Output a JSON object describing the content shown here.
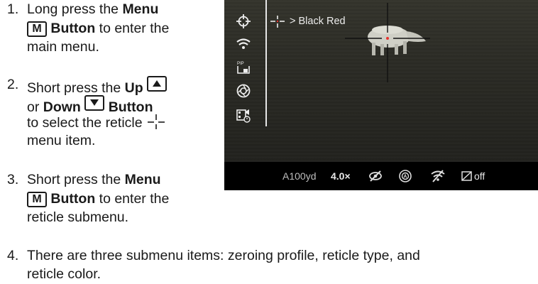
{
  "steps": [
    {
      "num": "1.",
      "lines": {
        "a_pre": "Long press the ",
        "a_bold": "Menu",
        "b_key": "M",
        "b_bold": "Button",
        "b_post": " to enter the",
        "c": "main menu."
      }
    },
    {
      "num": "2.",
      "lines": {
        "a_pre": "Short press the ",
        "a_bold": "Up",
        "b_pre": "or ",
        "b_bold1": "Down",
        "b_bold2": "Button",
        "c": "to select the reticle",
        "d": "menu item."
      }
    },
    {
      "num": "3.",
      "lines": {
        "a_pre": "Short press the ",
        "a_bold": "Menu",
        "b_key": "M",
        "b_bold": "Button",
        "b_post": " to enter the",
        "c": "reticle submenu."
      }
    },
    {
      "num": "4.",
      "lines": {
        "a": "There are three submenu items: zeroing profile, reticle type, and",
        "b": "reticle color."
      }
    }
  ],
  "device": {
    "submenu_label": "> Black Red",
    "menu_icons": [
      "reticle-icon",
      "wifi-icon",
      "pip-icon",
      "aperture-icon",
      "video-settings-icon"
    ],
    "status_bar": {
      "distance": "A100yd",
      "zoom": "4.0×",
      "visibility_off_icon": "eye-off-icon",
      "status_icon": "circle-a-icon",
      "wifi_off_icon": "wifi-off-icon",
      "pip_status": "off"
    },
    "colors": {
      "screen_bg": "#2a2a25",
      "status_bar_bg": "#000000",
      "reticle_red": "#e8322e"
    }
  }
}
